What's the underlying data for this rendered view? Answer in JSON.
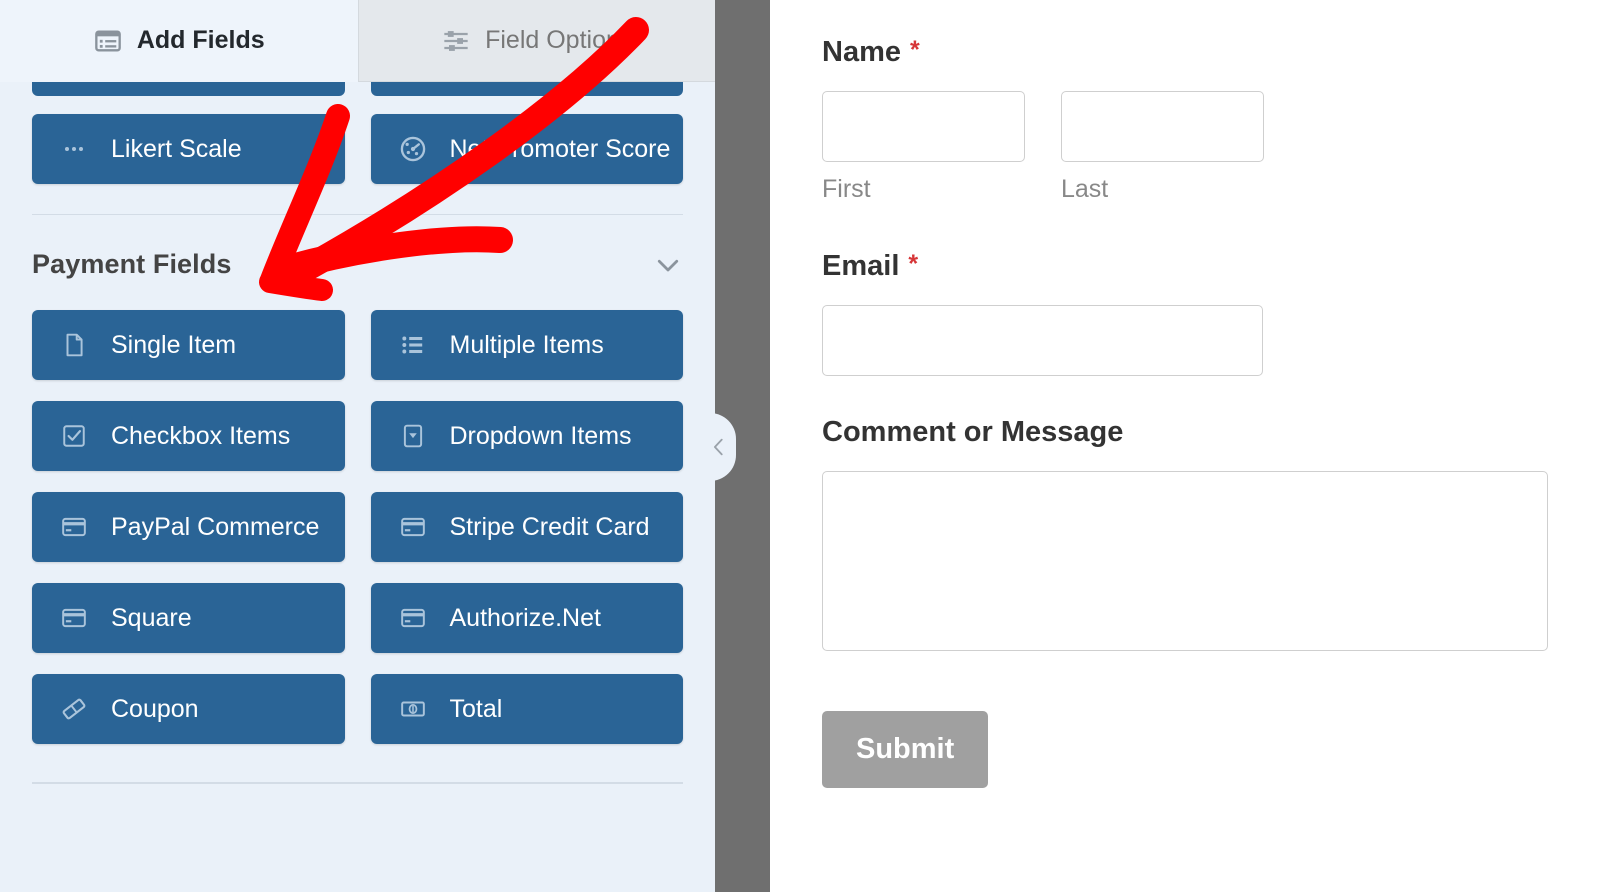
{
  "builder": {
    "tabs": [
      {
        "label": "Add Fields",
        "icon": "list-panel-icon",
        "active": true
      },
      {
        "label": "Field Options",
        "icon": "sliders-icon",
        "active": false
      }
    ],
    "visible_rows_above": [
      {
        "label": "Likert Scale",
        "icon": "dots-icon"
      },
      {
        "label": "Net Promoter Score",
        "icon": "gauge-icon"
      }
    ],
    "payment_section": {
      "title": "Payment Fields",
      "chevron": "chevron-down-icon",
      "fields": [
        {
          "label": "Single Item",
          "icon": "file-icon"
        },
        {
          "label": "Multiple Items",
          "icon": "list-bullets-icon"
        },
        {
          "label": "Checkbox Items",
          "icon": "checkbox-checked-icon"
        },
        {
          "label": "Dropdown Items",
          "icon": "dropdown-icon"
        },
        {
          "label": "PayPal Commerce",
          "icon": "credit-card-icon"
        },
        {
          "label": "Stripe Credit Card",
          "icon": "credit-card-icon"
        },
        {
          "label": "Square",
          "icon": "credit-card-icon"
        },
        {
          "label": "Authorize.Net",
          "icon": "credit-card-icon"
        },
        {
          "label": "Coupon",
          "icon": "coupon-ticket-icon"
        },
        {
          "label": "Total",
          "icon": "banknote-icon"
        }
      ]
    },
    "collapse_handle": {
      "icon": "chevron-left-icon"
    },
    "colors": {
      "field_button": "#2a6496",
      "panel_background": "#eaf1f9",
      "active_tab": "#eef4fb",
      "inactive_tab": "#e4e8ec",
      "gutter": "#6f6f6f"
    }
  },
  "preview": {
    "fields": [
      {
        "label": "Name",
        "required_marker": "*",
        "subfields": [
          {
            "sublabel": "First",
            "value": ""
          },
          {
            "sublabel": "Last",
            "value": ""
          }
        ]
      },
      {
        "label": "Email",
        "required_marker": "*",
        "value": ""
      },
      {
        "label": "Comment or Message",
        "required_marker": "",
        "value": ""
      }
    ],
    "submit_label": "Submit",
    "colors": {
      "required": "#d63638",
      "submit_background": "#a0a0a0"
    }
  },
  "annotation": {
    "type": "arrow",
    "color": "#ff0000",
    "points_to": "Payment Fields"
  }
}
